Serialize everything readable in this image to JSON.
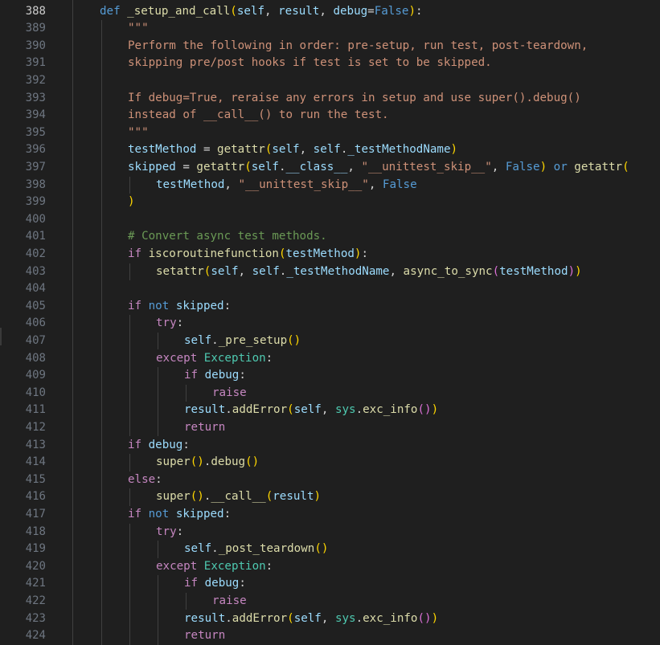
{
  "editor": {
    "active_line": 388,
    "theme": {
      "background": "#1f1f1f",
      "line_number": "#6e7681",
      "active_line_number": "#cccccc"
    },
    "lines": [
      {
        "n": "388",
        "indent": 1,
        "tokens": [
          [
            "kw",
            "def "
          ],
          [
            "fn",
            "_setup_and_call"
          ],
          [
            "b1",
            "("
          ],
          [
            "var",
            "self"
          ],
          [
            "op",
            ", "
          ],
          [
            "var",
            "result"
          ],
          [
            "op",
            ", "
          ],
          [
            "var",
            "debug"
          ],
          [
            "op",
            "="
          ],
          [
            "kw",
            "False"
          ],
          [
            "b1",
            ")"
          ],
          [
            "op",
            ":"
          ]
        ]
      },
      {
        "n": "389",
        "indent": 2,
        "tokens": [
          [
            "str",
            "\"\"\""
          ]
        ]
      },
      {
        "n": "390",
        "indent": 2,
        "tokens": [
          [
            "str",
            "Perform the following in order: pre-setup, run test, post-teardown,"
          ]
        ]
      },
      {
        "n": "391",
        "indent": 2,
        "tokens": [
          [
            "str",
            "skipping pre/post hooks if test is set to be skipped."
          ]
        ]
      },
      {
        "n": "392",
        "indent": 0,
        "tokens": []
      },
      {
        "n": "393",
        "indent": 2,
        "tokens": [
          [
            "str",
            "If debug=True, reraise any errors in setup and use super().debug()"
          ]
        ]
      },
      {
        "n": "394",
        "indent": 2,
        "tokens": [
          [
            "str",
            "instead of __call__() to run the test."
          ]
        ]
      },
      {
        "n": "395",
        "indent": 2,
        "tokens": [
          [
            "str",
            "\"\"\""
          ]
        ]
      },
      {
        "n": "396",
        "indent": 2,
        "tokens": [
          [
            "var",
            "testMethod"
          ],
          [
            "op",
            " = "
          ],
          [
            "fn",
            "getattr"
          ],
          [
            "b1",
            "("
          ],
          [
            "var",
            "self"
          ],
          [
            "op",
            ", "
          ],
          [
            "var",
            "self"
          ],
          [
            "op",
            "."
          ],
          [
            "var",
            "_testMethodName"
          ],
          [
            "b1",
            ")"
          ]
        ]
      },
      {
        "n": "397",
        "indent": 2,
        "tokens": [
          [
            "var",
            "skipped"
          ],
          [
            "op",
            " = "
          ],
          [
            "fn",
            "getattr"
          ],
          [
            "b1",
            "("
          ],
          [
            "var",
            "self"
          ],
          [
            "op",
            "."
          ],
          [
            "var",
            "__class__"
          ],
          [
            "op",
            ", "
          ],
          [
            "str",
            "\"__unittest_skip__\""
          ],
          [
            "op",
            ", "
          ],
          [
            "kw",
            "False"
          ],
          [
            "b1",
            ")"
          ],
          [
            "op",
            " "
          ],
          [
            "kw",
            "or"
          ],
          [
            "op",
            " "
          ],
          [
            "fn",
            "getattr"
          ],
          [
            "b1",
            "("
          ]
        ]
      },
      {
        "n": "398",
        "indent": 3,
        "tokens": [
          [
            "var",
            "testMethod"
          ],
          [
            "op",
            ", "
          ],
          [
            "str",
            "\"__unittest_skip__\""
          ],
          [
            "op",
            ", "
          ],
          [
            "kw",
            "False"
          ]
        ]
      },
      {
        "n": "399",
        "indent": 2,
        "tokens": [
          [
            "b1",
            ")"
          ]
        ]
      },
      {
        "n": "400",
        "indent": 0,
        "tokens": []
      },
      {
        "n": "401",
        "indent": 2,
        "tokens": [
          [
            "cmt",
            "# Convert async test methods."
          ]
        ]
      },
      {
        "n": "402",
        "indent": 2,
        "tokens": [
          [
            "ctl",
            "if"
          ],
          [
            "op",
            " "
          ],
          [
            "fn",
            "iscoroutinefunction"
          ],
          [
            "b1",
            "("
          ],
          [
            "var",
            "testMethod"
          ],
          [
            "b1",
            ")"
          ],
          [
            "op",
            ":"
          ]
        ]
      },
      {
        "n": "403",
        "indent": 3,
        "tokens": [
          [
            "fn",
            "setattr"
          ],
          [
            "b1",
            "("
          ],
          [
            "var",
            "self"
          ],
          [
            "op",
            ", "
          ],
          [
            "var",
            "self"
          ],
          [
            "op",
            "."
          ],
          [
            "var",
            "_testMethodName"
          ],
          [
            "op",
            ", "
          ],
          [
            "fn",
            "async_to_sync"
          ],
          [
            "b2",
            "("
          ],
          [
            "var",
            "testMethod"
          ],
          [
            "b2",
            ")"
          ],
          [
            "b1",
            ")"
          ]
        ]
      },
      {
        "n": "404",
        "indent": 0,
        "tokens": []
      },
      {
        "n": "405",
        "indent": 2,
        "tokens": [
          [
            "ctl",
            "if"
          ],
          [
            "op",
            " "
          ],
          [
            "kw",
            "not"
          ],
          [
            "op",
            " "
          ],
          [
            "var",
            "skipped"
          ],
          [
            "op",
            ":"
          ]
        ]
      },
      {
        "n": "406",
        "indent": 3,
        "tokens": [
          [
            "ctl",
            "try"
          ],
          [
            "op",
            ":"
          ]
        ]
      },
      {
        "n": "407",
        "indent": 4,
        "tokens": [
          [
            "var",
            "self"
          ],
          [
            "op",
            "."
          ],
          [
            "fn",
            "_pre_setup"
          ],
          [
            "b1",
            "()"
          ]
        ]
      },
      {
        "n": "408",
        "indent": 3,
        "tokens": [
          [
            "ctl",
            "except"
          ],
          [
            "op",
            " "
          ],
          [
            "cls",
            "Exception"
          ],
          [
            "op",
            ":"
          ]
        ]
      },
      {
        "n": "409",
        "indent": 4,
        "tokens": [
          [
            "ctl",
            "if"
          ],
          [
            "op",
            " "
          ],
          [
            "var",
            "debug"
          ],
          [
            "op",
            ":"
          ]
        ]
      },
      {
        "n": "410",
        "indent": 5,
        "tokens": [
          [
            "ctl",
            "raise"
          ]
        ]
      },
      {
        "n": "411",
        "indent": 4,
        "tokens": [
          [
            "var",
            "result"
          ],
          [
            "op",
            "."
          ],
          [
            "fn",
            "addError"
          ],
          [
            "b1",
            "("
          ],
          [
            "var",
            "self"
          ],
          [
            "op",
            ", "
          ],
          [
            "cls",
            "sys"
          ],
          [
            "op",
            "."
          ],
          [
            "fn",
            "exc_info"
          ],
          [
            "b2",
            "()"
          ],
          [
            "b1",
            ")"
          ]
        ]
      },
      {
        "n": "412",
        "indent": 4,
        "tokens": [
          [
            "ctl",
            "return"
          ]
        ]
      },
      {
        "n": "413",
        "indent": 2,
        "tokens": [
          [
            "ctl",
            "if"
          ],
          [
            "op",
            " "
          ],
          [
            "var",
            "debug"
          ],
          [
            "op",
            ":"
          ]
        ]
      },
      {
        "n": "414",
        "indent": 3,
        "tokens": [
          [
            "fn",
            "super"
          ],
          [
            "b1",
            "()"
          ],
          [
            "op",
            "."
          ],
          [
            "fn",
            "debug"
          ],
          [
            "b1",
            "()"
          ]
        ]
      },
      {
        "n": "415",
        "indent": 2,
        "tokens": [
          [
            "ctl",
            "else"
          ],
          [
            "op",
            ":"
          ]
        ]
      },
      {
        "n": "416",
        "indent": 3,
        "tokens": [
          [
            "fn",
            "super"
          ],
          [
            "b1",
            "()"
          ],
          [
            "op",
            "."
          ],
          [
            "fn",
            "__call__"
          ],
          [
            "b1",
            "("
          ],
          [
            "var",
            "result"
          ],
          [
            "b1",
            ")"
          ]
        ]
      },
      {
        "n": "417",
        "indent": 2,
        "tokens": [
          [
            "ctl",
            "if"
          ],
          [
            "op",
            " "
          ],
          [
            "kw",
            "not"
          ],
          [
            "op",
            " "
          ],
          [
            "var",
            "skipped"
          ],
          [
            "op",
            ":"
          ]
        ]
      },
      {
        "n": "418",
        "indent": 3,
        "tokens": [
          [
            "ctl",
            "try"
          ],
          [
            "op",
            ":"
          ]
        ]
      },
      {
        "n": "419",
        "indent": 4,
        "tokens": [
          [
            "var",
            "self"
          ],
          [
            "op",
            "."
          ],
          [
            "fn",
            "_post_teardown"
          ],
          [
            "b1",
            "()"
          ]
        ]
      },
      {
        "n": "420",
        "indent": 3,
        "tokens": [
          [
            "ctl",
            "except"
          ],
          [
            "op",
            " "
          ],
          [
            "cls",
            "Exception"
          ],
          [
            "op",
            ":"
          ]
        ]
      },
      {
        "n": "421",
        "indent": 4,
        "tokens": [
          [
            "ctl",
            "if"
          ],
          [
            "op",
            " "
          ],
          [
            "var",
            "debug"
          ],
          [
            "op",
            ":"
          ]
        ]
      },
      {
        "n": "422",
        "indent": 5,
        "tokens": [
          [
            "ctl",
            "raise"
          ]
        ]
      },
      {
        "n": "423",
        "indent": 4,
        "tokens": [
          [
            "var",
            "result"
          ],
          [
            "op",
            "."
          ],
          [
            "fn",
            "addError"
          ],
          [
            "b1",
            "("
          ],
          [
            "var",
            "self"
          ],
          [
            "op",
            ", "
          ],
          [
            "cls",
            "sys"
          ],
          [
            "op",
            "."
          ],
          [
            "fn",
            "exc_info"
          ],
          [
            "b2",
            "()"
          ],
          [
            "b1",
            ")"
          ]
        ]
      },
      {
        "n": "424",
        "indent": 4,
        "tokens": [
          [
            "ctl",
            "return"
          ]
        ]
      }
    ]
  }
}
